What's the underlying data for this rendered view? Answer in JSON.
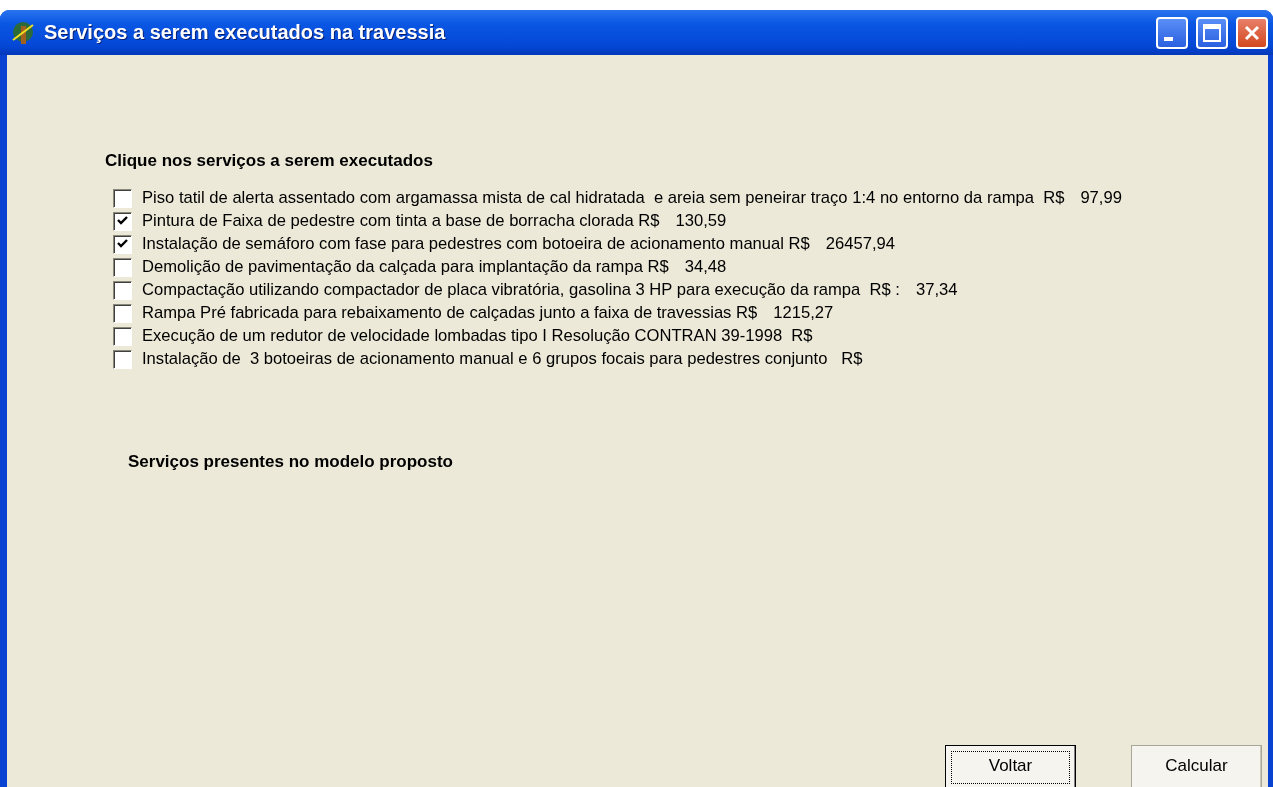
{
  "window": {
    "title": "Serviços a serem executados na travessia"
  },
  "services_heading": "Clique nos serviços a serem executados",
  "services": [
    {
      "label": "Piso tatil de alerta assentado com argamassa mista de cal hidratada  e areia sem peneirar traço 1:4 no entorno da rampa  R$",
      "price": "97,99",
      "checked": false
    },
    {
      "label": "Pintura de Faixa de pedestre com tinta a base de borracha clorada R$",
      "price": "130,59",
      "checked": true
    },
    {
      "label": "Instalação de semáforo com fase para pedestres com botoeira de acionamento manual R$",
      "price": "26457,94",
      "checked": true
    },
    {
      "label": "Demolição de pavimentação da calçada para implantação da rampa R$",
      "price": "34,48",
      "checked": false
    },
    {
      "label": "Compactação utilizando compactador de placa vibratória, gasolina 3 HP para execução da rampa  R$ :",
      "price": "37,34",
      "checked": false
    },
    {
      "label": "Rampa Pré fabricada para rebaixamento de calçadas junto a faixa de travessias R$",
      "price": "1215,27",
      "checked": false
    },
    {
      "label": "Execução de um redutor de velocidade lombadas tipo I Resolução CONTRAN 39-1998  R$",
      "checked": false
    },
    {
      "label": "Instalação de  3 botoeiras de acionamento manual e 6 grupos focais para pedestres conjunto   R$",
      "checked": false
    }
  ],
  "model_heading": "Serviços presentes no modelo proposto",
  "buttons": [
    {
      "label": "Voltar",
      "focused": true
    },
    {
      "label": "Calcular",
      "focused": false
    }
  ]
}
